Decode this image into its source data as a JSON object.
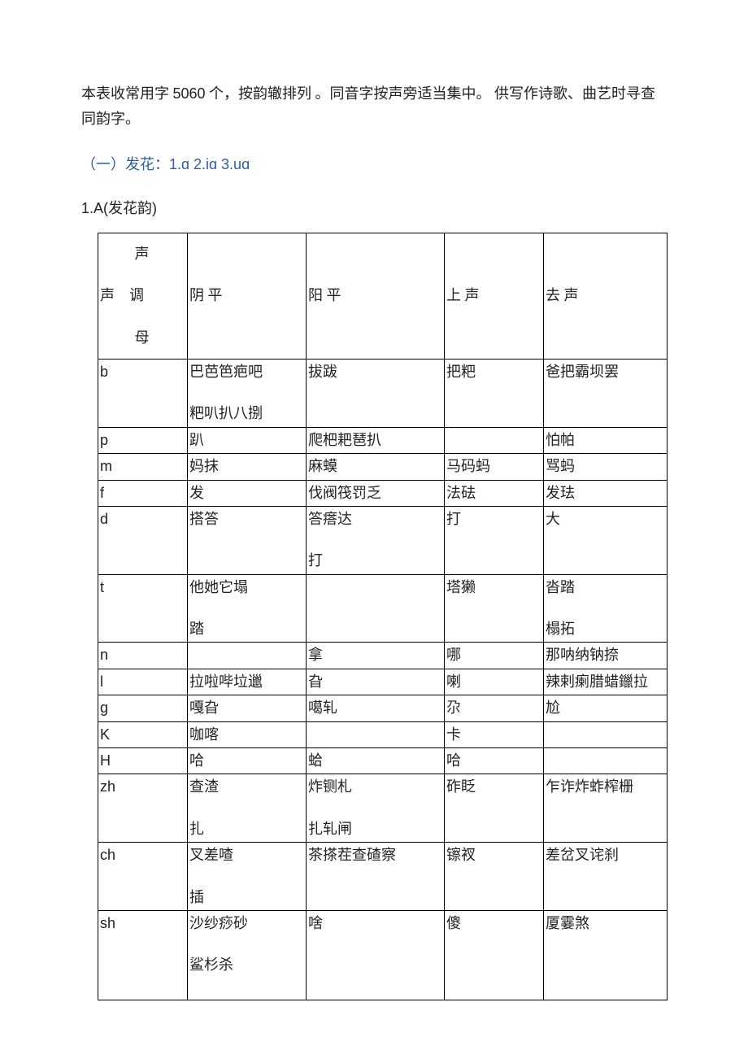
{
  "intro": {
    "p1a": "本表收常用字 ",
    "count": "5060",
    "p1b": " 个，按韵辙排列 。同音字按声旁适当集中。 供写作诗歌、曲艺时寻查同韵字。"
  },
  "section": {
    "prefix": "（一）发花：",
    "codes": "1.ɑ 2.iɑ 3.uɑ"
  },
  "subtitle": {
    "num": "1.A(",
    "cn": "发花韵",
    "close": ")"
  },
  "header": {
    "col0a": "声",
    "col0b_left": "声",
    "col0b_right": "调",
    "col0c": "母",
    "c1": "阴  平",
    "c2": "阳  平",
    "c3": "上  声",
    "c4": "去  声"
  },
  "rows": [
    {
      "sm": "b",
      "c1a": "巴芭笆疤吧",
      "c1b": "粑叭扒八捌",
      "c2": "拔跋",
      "c3": "把粑",
      "c4": "爸把霸坝罢"
    },
    {
      "sm": "p",
      "c1": "趴",
      "c2": "爬杷耙琶扒",
      "c3": "",
      "c4": "怕帕"
    },
    {
      "sm": "m",
      "c1": "妈抹",
      "c2": "麻蟆",
      "c3": "马码蚂",
      "c4": "骂蚂"
    },
    {
      "sm": "f",
      "c1": "发",
      "c2": "伐阀筏罚乏",
      "c3": "法砝",
      "c4": "发珐"
    },
    {
      "sm": "d",
      "c1": "搭答",
      "c2a": "答瘩达",
      "c2b": "打",
      "c3": "打",
      "c4": "大"
    },
    {
      "sm": "t",
      "c1a": "他她它塌",
      "c1b": "踏",
      "c2": "",
      "c3": "塔獭",
      "c4a": "沓踏",
      "c4b": "榻拓"
    },
    {
      "sm": "n",
      "c1": "",
      "c2": "拿",
      "c3": "哪",
      "c4": "那呐纳钠捺"
    },
    {
      "sm": "l",
      "c1": "拉啦哔垃邋",
      "c2": "旮",
      "c3": "喇",
      "c4": "辣剌瘌腊蜡鑞拉"
    },
    {
      "sm": "g",
      "c1": "嘎旮",
      "c2": "噶轧",
      "c3": "尕",
      "c4": "尬"
    },
    {
      "sm": "K",
      "c1": "咖喀",
      "c2": "",
      "c3": "卡",
      "c4": ""
    },
    {
      "sm": "H",
      "c1": "哈",
      "c2": "蛤",
      "c3": "哈",
      "c4": ""
    },
    {
      "sm": "zh",
      "c1a": "查渣",
      "c1b": "扎",
      "c2a": "炸铡札",
      "c2b": "扎轧闸",
      "c3": "砟眨",
      "c4": "乍诈炸蚱榨栅"
    },
    {
      "sm": "ch",
      "c1a": "叉差喳",
      "c1b": "插",
      "c2": "茶搽茬查碴察",
      "c3": "镲衩",
      "c4": "差岔叉诧刹"
    },
    {
      "sm": "sh",
      "c1a": "沙纱痧砂",
      "c1b": "鲨杉杀",
      "c2": "啥",
      "c3": "傻",
      "c4": "厦霎煞"
    }
  ]
}
